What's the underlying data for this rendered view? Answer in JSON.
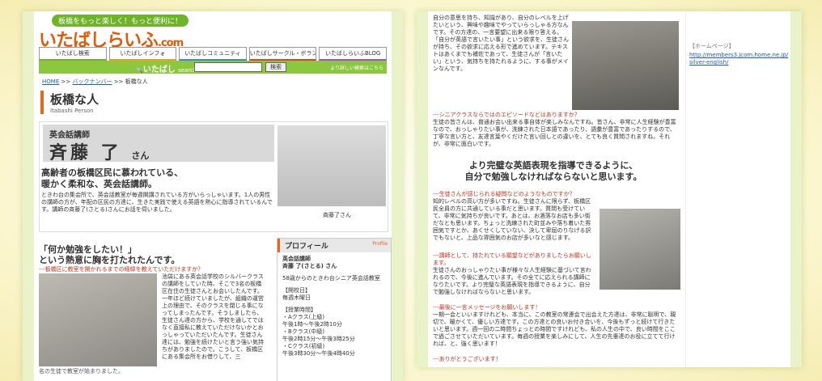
{
  "left": {
    "tagline": "板橋をもっと楽しく！もっと便利に！",
    "logo": "いたばしらいふ",
    "logo_suffix": ".com",
    "nav": [
      "いたばし検索",
      "いたばしインフォ",
      "いたばしコミュニティ",
      "いたばしサークル・ボランティア",
      "いたばしらいふBLOG"
    ],
    "search_brand": "いたばし",
    "search_brand_sub": "search",
    "search_button": "検索",
    "search_more": "より詳しい検索はこちら",
    "breadcrumb": {
      "home": "HOME",
      "back": "バックナンバー",
      "current": "板橋な人",
      "sep": ">>"
    },
    "page_title": "板橋な人",
    "page_title_en": "Itabashi Person",
    "role": "英会話講師",
    "person_name": "斉藤 了",
    "honorific": "さん",
    "photo_caption": "斉藤了さん",
    "hero_head_1": "高齢者の板橋区民に慕われている、",
    "hero_head_2": "暖かく柔和な、英会話講師。",
    "hero_body": "ときわ台の集会所で、英会話教室が毎週開講されている方がいらっしゃいます。1人の男性の講師の方が、年配の区民の方達に、生きた実践で使える英語を熱心に指導されているんです。講師の斉藤了(さとる)さんにお話を伺いました。",
    "q1_title_1": "「何か勉強をしたい！」",
    "q1_title_2": "という熱意に胸を打たれたんです。",
    "q1_sub": "---板橋区に教室を開かれるまでの経緯を教えていただけますか？",
    "q1_body": "池袋にある英会話学校のシルバークラスの講師をしていた時、そこで3名の板橋区在住の生徒さんとお会いしたんです。一年ほど続けていましたが、組織の運営上の理由で、そのクラスを閉じる事になってしまったんです。そうしましたら、生徒さん達の方から、学校を通してではなく直接私に教えていただけないかとおっしゃっていただいたんです。生徒さん達には、勉強を続けたいと言う強い気持ちがありましたので。こうして、板橋区にある集会所をお借りして、三",
    "foot1": "名の生徒で教室が始まりました。",
    "profile": {
      "heading": "プロフィール",
      "tag": "Profile",
      "role": "英会話講師",
      "name": "斉藤 了(さとる) さん",
      "org": "58歳からのときわ台シニア英会話教室",
      "day_label": "【開校日】",
      "day": "毎週木曜日",
      "time_label": "【授業時間】",
      "time_a": "・Aクラス(上級)",
      "time_a2": "午後1時〜午後2時10分",
      "time_b": "・Bクラス(中級)",
      "time_b2": "午後2時15分〜午後3時25分",
      "time_c": "・Cクラス(初級)",
      "time_c2": "午後3時30分〜午後4時40分"
    }
  },
  "right": {
    "intro": "自分の意思を持ち、知識があり、自分のレベルを上げたいという、興味や趣味でやっていらっしゃる方なんです。その方達の、一言要望に出来る限り答える。「自分が英語で言いたい事」という欲求を、生徒さんが持ち、その欲求に応える形で進めています。テキストはあくまでも補佐であって、生徒さんが「言いたい」という、気持ちを持たれるように、する事がメインなんです。",
    "q2": "---シニアクラスならではのエピソードなどはありますか？",
    "a2": "生徒の皆さんは、普通お会い出来る事自体が楽しみなんですね。皆さん、非常に人生経験が豊富なので、おっしゃりたい事が、洗練された日本語であったり、語彙が豊富であったりするので、丁寧な言い方と、友達言葉やくだけた言い回しとの違いを、とても良く質問されますね。それが、非常に面白いです。",
    "head_1": "より完璧な英語表現を指導できるように、",
    "head_2": "自分で勉強しなければならないと思います。",
    "q3": "---生徒さんが感じられる疑問などのようなものですか？",
    "a3": "知的レベルの高い方が多いですね。生徒さんに限らず、板橋区民全員の方に共通している事だと思います。質問も受けていて、非常に気持ちが良いです。あとは、お酒落なお店も多い街だなとも思います。ちょっと洗練された町並みや落ち着いた雰囲気ですとか、あくせくしていない、決して卑屈のりなげる訳でもないと、上品な雰囲気のお店が多いなと感じます。",
    "q4": "---講師として、持たれている願望などがありましたらお願いします。",
    "a4": "生徒さんのおっしゃりたい事が様々な人生経験に基づいて言われるので、今後に進んでいます。その全てに応えられる講師になりたいです。より完璧な英語表現を指導できるように、自分で勉強しなければならないと思います。",
    "q5": "---最後に一言メッセージをお願いします！",
    "a5": "一期一会といいますけれども、本当に、この教室の常連会で出会えた方達は、非常に聡明で、親切で、暖かくて、優しい方達です。この方達との良いお付き合いを、今後もずっと続けて行きたいと思います。週一回の二時間ちょっとの時間ですけれども、私の人生の中で、良い時間をここで過ごさせていただいています。毎週の授業を楽しみにして、人生の先輩達のお役に立てて行ければ、と、強く思います！",
    "closing": "---ありがとうございます！",
    "side_hp_label": "【ホームページ】",
    "side_url_1": "http://members3.jcom.home.ne.jp/",
    "side_url_2": "silver-english/"
  }
}
